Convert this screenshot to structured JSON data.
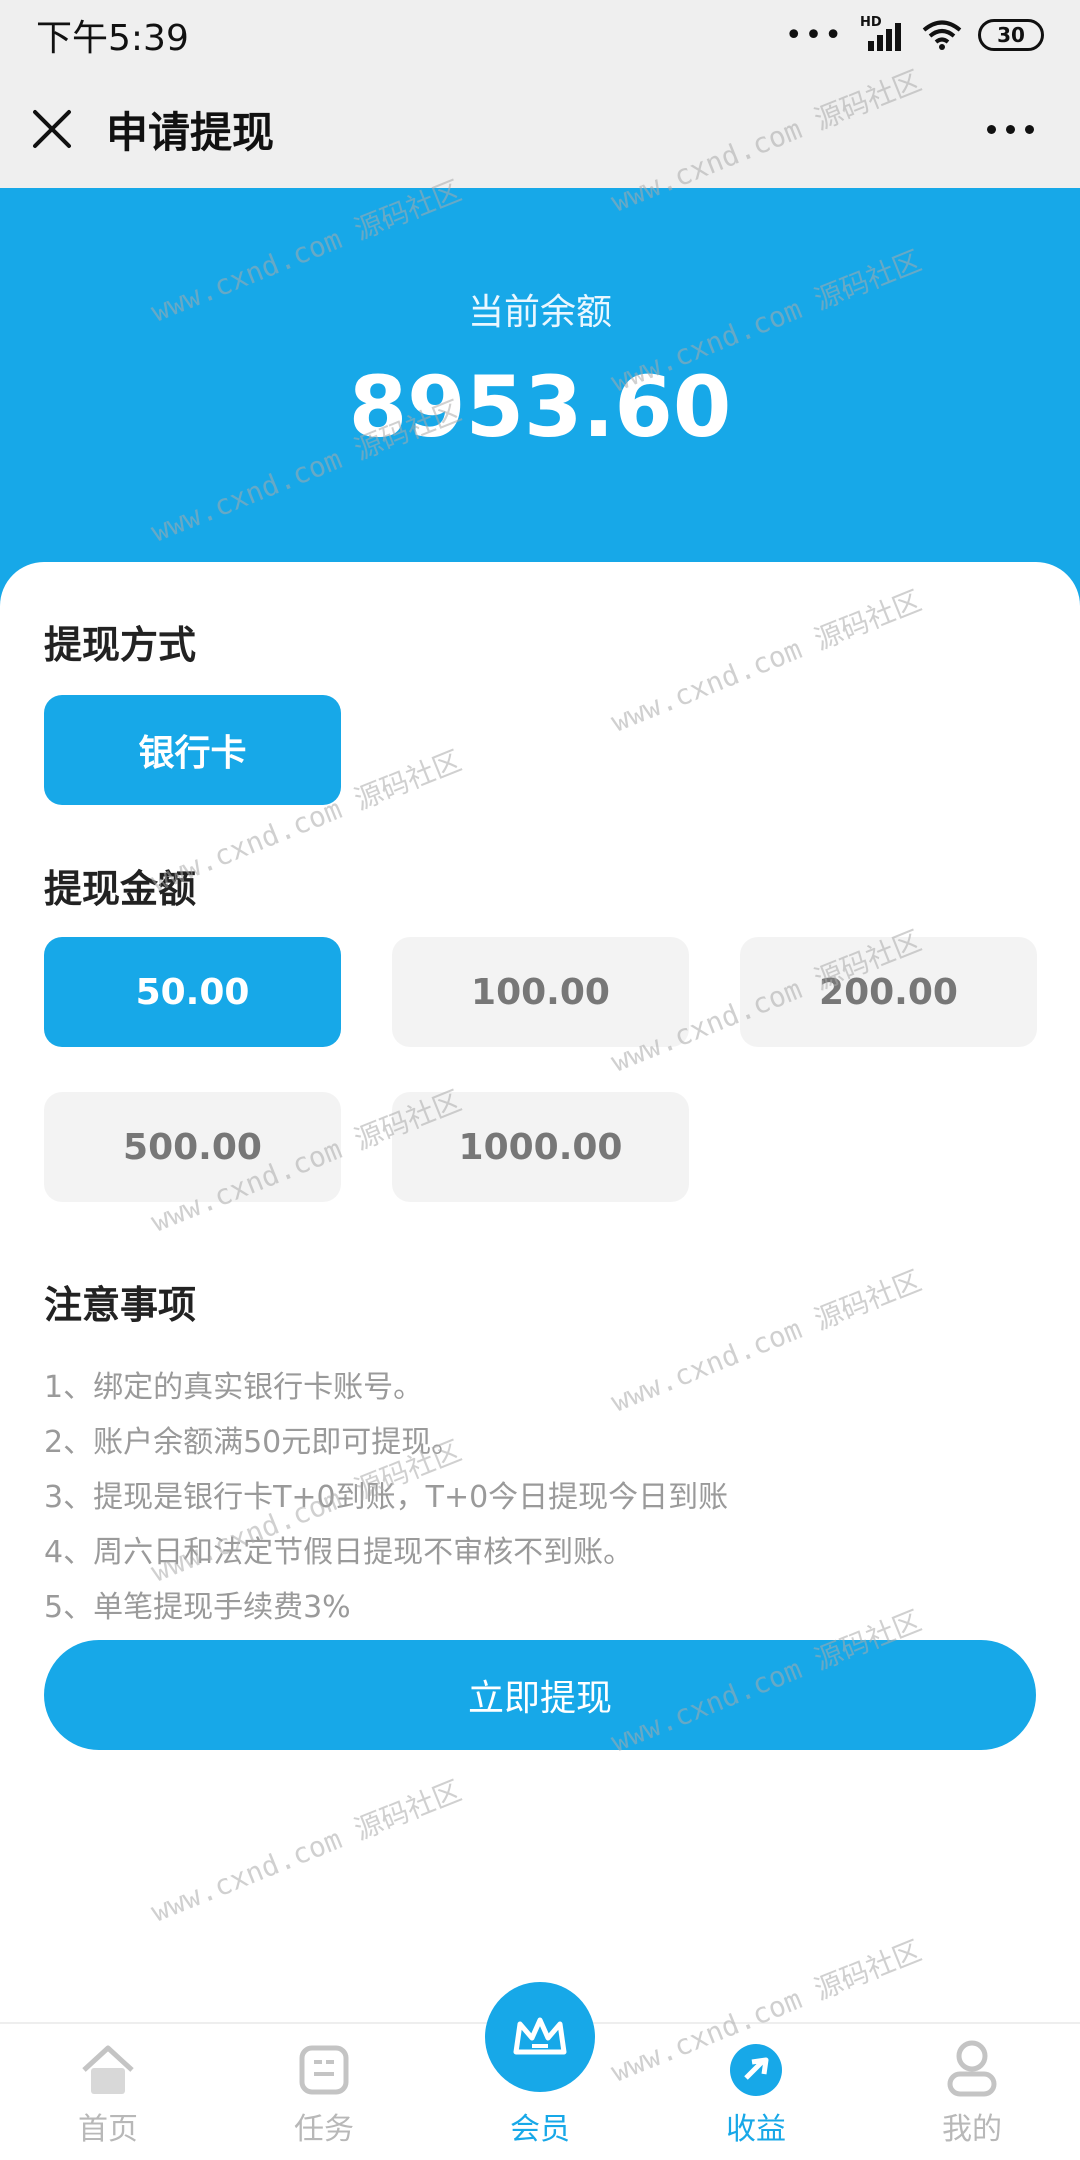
{
  "status_bar": {
    "time": "下午5:39",
    "signal_badge": "HD",
    "battery": "30"
  },
  "nav": {
    "title": "申请提现"
  },
  "hero": {
    "balance_label": "当前余额",
    "balance_value": "8953.60"
  },
  "withdraw_method": {
    "title": "提现方式",
    "options": [
      "银行卡"
    ],
    "selected": "银行卡"
  },
  "withdraw_amount": {
    "title": "提现金额",
    "options": [
      "50.00",
      "100.00",
      "200.00",
      "500.00",
      "1000.00"
    ],
    "selected": "50.00"
  },
  "notice": {
    "title": "注意事项",
    "items": [
      "1、绑定的真实银行卡账号。",
      "2、账户余额满50元即可提现。",
      "3、提现是银行卡T+0到账，T+0今日提现今日到账",
      "4、周六日和法定节假日提现不审核不到账。",
      "5、单笔提现手续费3%"
    ]
  },
  "submit_label": "立即提现",
  "tabbar": {
    "items": [
      {
        "label": "首页",
        "icon": "home-icon"
      },
      {
        "label": "任务",
        "icon": "task-icon"
      },
      {
        "label": "会员",
        "icon": "crown-icon"
      },
      {
        "label": "收益",
        "icon": "earnings-icon"
      },
      {
        "label": "我的",
        "icon": "profile-icon"
      }
    ],
    "active": "收益"
  },
  "watermark": "www.cxnd.com 源码社区",
  "colors": {
    "accent": "#17a8e8",
    "header_bg": "#efefef",
    "chip_inactive_bg": "#f3f3f3"
  }
}
